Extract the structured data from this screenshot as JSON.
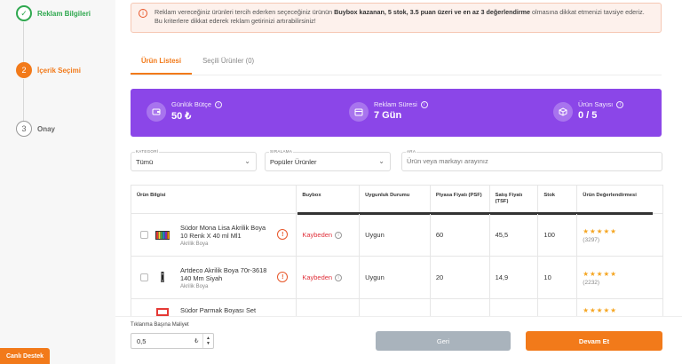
{
  "steps": [
    {
      "number": "✓",
      "label": "Reklam Bilgileri",
      "state": "done"
    },
    {
      "number": "2",
      "label": "İçerik Seçimi",
      "state": "active"
    },
    {
      "number": "3",
      "label": "Onay",
      "state": "todo"
    }
  ],
  "alert": {
    "text_1": "Reklam vereceğiniz ürünleri tercih ederken seçeceğiniz ürünün ",
    "bold": "Buybox kazanan, 5 stok, 3.5 puan üzeri ve en az 3 değerlendirme",
    "text_2": " olmasına dikkat etmenizi tavsiye ederiz. Bu kriterlere dikkat ederek reklam getirinizi artırabilirsiniz!"
  },
  "tabs": [
    {
      "label": "Ürün Listesi",
      "active": true
    },
    {
      "label": "Seçili Ürünler (0)",
      "active": false
    }
  ],
  "stats": [
    {
      "label": "Günlük Bütçe",
      "value": "50 ₺",
      "icon": "wallet-icon"
    },
    {
      "label": "Reklam Süresi",
      "value": "7 Gün",
      "icon": "calendar-icon"
    },
    {
      "label": "Ürün Sayısı",
      "value": "0 / 5",
      "icon": "box-icon"
    }
  ],
  "filters": {
    "category": {
      "caption": "KATEGORİ",
      "value": "Tümü"
    },
    "sort": {
      "caption": "SIRALAMA",
      "value": "Popüler Ürünler"
    },
    "search": {
      "caption": "ARA",
      "placeholder": "Ürün veya markayı arayınız"
    }
  },
  "table": {
    "headers": [
      "Ürün Bilgisi",
      "Buybox",
      "Uygunluk Durumu",
      "Piyasa Fiyatı (PSF)",
      "Satış Fiyatı (TSF)",
      "Stok",
      "Ürün Değerlendirmesi"
    ],
    "rows": [
      {
        "name": "Südor Mona Lisa Akrilik Boya 10 Renk X 40 ml Ml1",
        "brand": "Akrilik Boya",
        "buybox": "Kaybeden",
        "status": "Uygun",
        "psf": "60",
        "tsf": "45,5",
        "stock": "100",
        "stars": "★★★★★",
        "reviews": "(3297)"
      },
      {
        "name": "Artdeco Akrilik Boya 70r-3618 140 Mm Siyah",
        "brand": "Akrilik Boya",
        "buybox": "Kaybeden",
        "status": "Uygun",
        "psf": "20",
        "tsf": "14,9",
        "stock": "10",
        "stars": "★★★★★",
        "reviews": "(2232)"
      },
      {
        "name": "Südor Parmak Boyası Set",
        "brand": "",
        "buybox": "",
        "status": "",
        "psf": "",
        "tsf": "",
        "stock": "",
        "stars": "★★★★★",
        "reviews": ""
      }
    ]
  },
  "bottom": {
    "cpc_label": "Tıklanma Başına Maliyet",
    "cpc_value": "0,5",
    "cpc_unit": "₺",
    "back_label": "Geri",
    "next_label": "Devam Et"
  },
  "live_support": "Canlı Destek",
  "colors": {
    "accent": "#f27a1a",
    "purple": "#8b46e8",
    "success": "#2fa84f",
    "danger": "#e0323c"
  }
}
